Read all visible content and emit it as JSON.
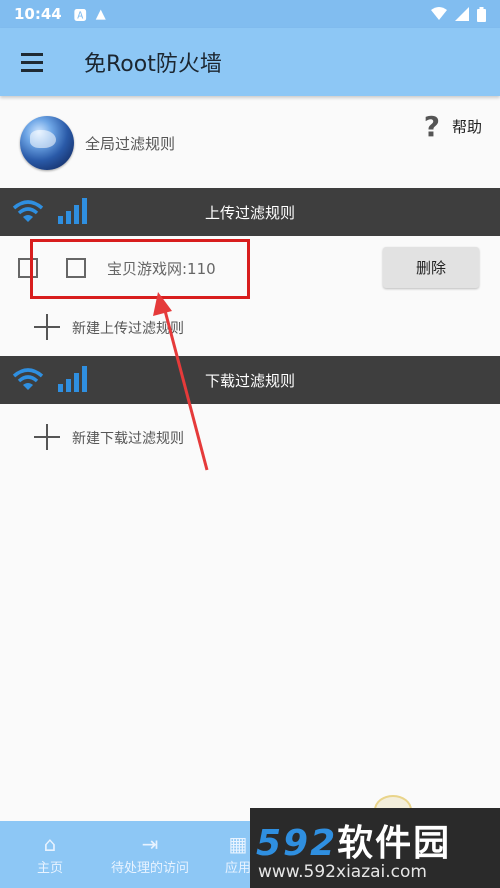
{
  "status_bar": {
    "time": "10:44",
    "icons": [
      "a-badge-icon",
      "warning-icon"
    ],
    "right_icons": [
      "wifi-icon",
      "signal-icon",
      "battery-icon"
    ]
  },
  "app_bar": {
    "title": "免Root防火墙"
  },
  "global": {
    "label": "全局过滤规则",
    "help_label": "帮助"
  },
  "upload_section": {
    "title": "上传过滤规则"
  },
  "rules": [
    {
      "text": "宝贝游戏网:110",
      "delete_label": "删除"
    }
  ],
  "upload_add": {
    "label": "新建上传过滤规则"
  },
  "download_section": {
    "title": "下载过滤规则"
  },
  "download_add": {
    "label": "新建下载过滤规则"
  },
  "bottom_nav": [
    {
      "label": "主页",
      "icon": "home-icon"
    },
    {
      "label": "待处理的访问",
      "icon": "pending-arrow-icon"
    },
    {
      "label": "应用",
      "icon": "apps-grid-icon"
    }
  ],
  "watermark": {
    "text_num": "592",
    "text_cn": "软件园",
    "url": "www.592xiazai.com"
  },
  "colors": {
    "app_bar": "#8dc7f5",
    "section_header": "#3e3e3e",
    "accent_blue": "#2f8fe0",
    "highlight_red": "#d81d1d"
  }
}
